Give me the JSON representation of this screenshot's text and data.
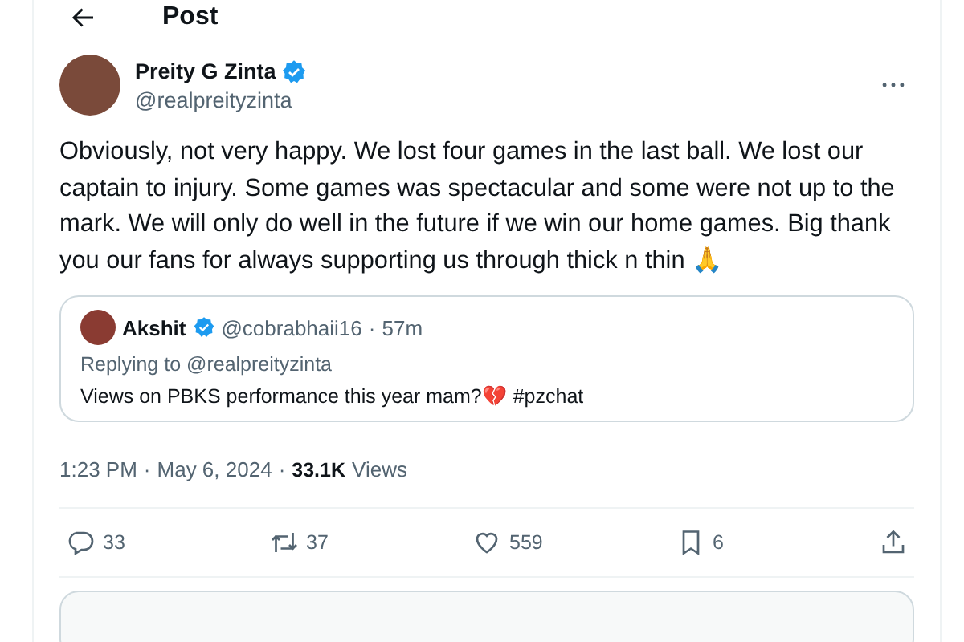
{
  "header": {
    "title": "Post"
  },
  "post": {
    "name": "Preity G Zinta",
    "verified": true,
    "handle": "@realpreityzinta",
    "text": "Obviously, not very happy. We lost four games in the last ball. We lost our captain to injury. Some games was spectacular and some were not up to the mark. We will only do well in the future if we win our home games. Big thank you our fans for always supporting us through thick n thin 🙏",
    "quote": {
      "name": "Akshit",
      "verified": true,
      "handle": "@cobrabhaii16",
      "separator": "·",
      "time": "57m",
      "replying_to": "Replying to @realpreityzinta",
      "text": "Views on PBKS performance this year mam?💔 #pzchat"
    },
    "separator": "·",
    "time": "1:23 PM",
    "date": "May 6, 2024",
    "views_count": "33.1K",
    "views_label": "Views",
    "actions": [
      {
        "kind": "reply",
        "count": "33"
      },
      {
        "kind": "repost",
        "count": "37"
      },
      {
        "kind": "like",
        "count": "559"
      },
      {
        "kind": "bookmark",
        "count": "6"
      },
      {
        "kind": "share"
      }
    ]
  }
}
